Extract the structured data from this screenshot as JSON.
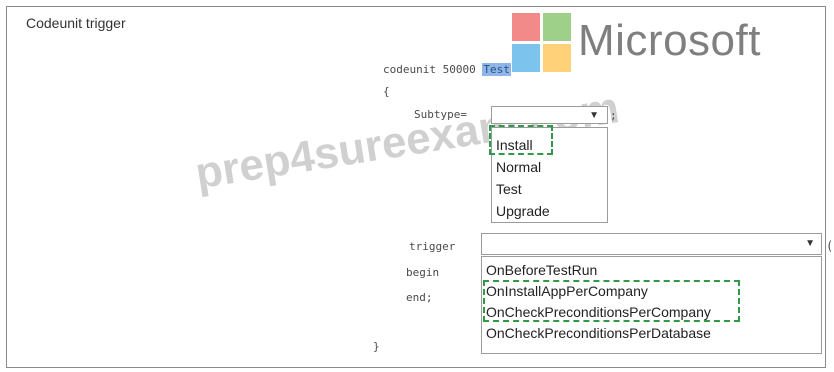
{
  "title": "Codeunit trigger",
  "brand": {
    "name": "Microsoft",
    "colors": [
      "#f25022",
      "#7fba00",
      "#00a4ef",
      "#ffb900"
    ]
  },
  "watermark": "prep4sureexam.com",
  "code": {
    "header_prefix": "codeunit 50000 ",
    "header_name": "Test",
    "open_brace": "{",
    "subtype_label": "Subtype=",
    "subtype_semicolon": ";",
    "trigger_label": "trigger",
    "trigger_paren": "(",
    "begin_label": "begin",
    "end_label": "end;",
    "close_brace": "}"
  },
  "subtype_dropdown": {
    "value": "",
    "arrow_icon": "chevron-down",
    "options": [
      "Install",
      "Normal",
      "Test",
      "Upgrade"
    ],
    "marked_option": "Install"
  },
  "trigger_dropdown": {
    "value": "",
    "arrow_icon": "chevron-down",
    "options": [
      "OnBeforeTestRun",
      "OnInstallAppPerCompany",
      "OnCheckPreconditionsPerCompany",
      "OnCheckPreconditionsPerDatabase"
    ],
    "marked_option": "OnInstallAppPerCompany"
  },
  "accent_colors": {
    "highlight": "#8fb6e8",
    "dashed_marker": "#2f9b47"
  }
}
